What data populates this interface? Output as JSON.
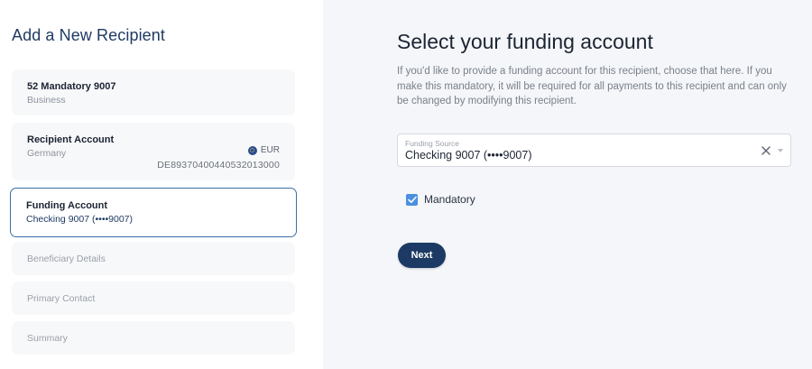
{
  "sidebar": {
    "title": "Add a New Recipient",
    "steps": [
      {
        "title": "52 Mandatory 9007",
        "subtitle": "Business"
      },
      {
        "title": "Recipient Account",
        "subtitle": "Germany",
        "currency": "EUR",
        "iban": "DE89370400440532013000"
      },
      {
        "title": "Funding Account",
        "subtitle": "Checking 9007 (••••9007)"
      },
      {
        "label": "Beneficiary Details"
      },
      {
        "label": "Primary Contact"
      },
      {
        "label": "Summary"
      }
    ]
  },
  "main": {
    "title": "Select your funding account",
    "description": "If you'd like to provide a funding account for this recipient, choose that here. If you make this mandatory, it will be required for all payments to this recipient and can only be changed by modifying this recipient.",
    "funding_source": {
      "label": "Funding Source",
      "value": "Checking 9007 (••••9007)"
    },
    "mandatory": {
      "label": "Mandatory",
      "checked": true
    },
    "next_label": "Next"
  },
  "colors": {
    "accent": "#1c3a64",
    "active_border": "#3b6fa6",
    "checkbox": "#4a8fe0"
  }
}
